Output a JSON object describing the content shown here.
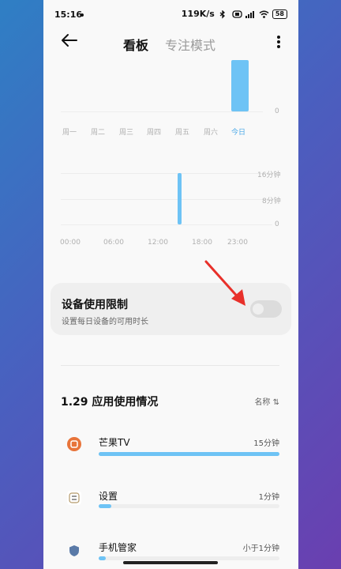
{
  "status_bar": {
    "time": "15:16",
    "network_speed": "119K/s",
    "battery": "58"
  },
  "header": {
    "tab_active": "看板",
    "tab_inactive": "专注模式"
  },
  "week_chart": {
    "y_tick": "0",
    "days": [
      "周一",
      "周二",
      "周三",
      "周四",
      "周五",
      "周六",
      "今日"
    ],
    "today_color": "#4aa8e8"
  },
  "day_chart": {
    "y_ticks": [
      "16分钟",
      "8分钟",
      "0"
    ],
    "x_ticks": [
      "00:00",
      "06:00",
      "12:00",
      "18:00",
      "23:00"
    ]
  },
  "chart_data": [
    {
      "type": "bar",
      "categories": [
        "周一",
        "周二",
        "周三",
        "周四",
        "周五",
        "周六",
        "今日"
      ],
      "values": [
        0,
        0,
        0,
        0,
        0,
        0,
        1
      ]
    },
    {
      "type": "bar",
      "x_ticks": [
        "00:00",
        "06:00",
        "12:00",
        "18:00",
        "23:00"
      ],
      "y_ticks": [
        "16分钟",
        "8分钟",
        "0"
      ],
      "series": [
        {
          "x": "15:00",
          "value_minutes": 16
        }
      ]
    }
  ],
  "device_limit": {
    "title": "设备使用限制",
    "subtitle": "设置每日设备的可用时长",
    "enabled": false
  },
  "usage": {
    "title": "1.29 应用使用情况",
    "sort_label": "名称 ⇅",
    "apps": [
      {
        "name": "芒果TV",
        "time": "15分钟",
        "progress": 1.0,
        "icon": "mango-tv-icon",
        "color": "#e8743a"
      },
      {
        "name": "设置",
        "time": "1分钟",
        "progress": 0.07,
        "icon": "settings-icon",
        "color": "#888888"
      },
      {
        "name": "手机管家",
        "time": "小于1分钟",
        "progress": 0.04,
        "icon": "phone-manager-icon",
        "color": "#5a7aa8"
      }
    ]
  },
  "colors": {
    "bar": "#6ec3f5",
    "arrow": "#e8302a"
  }
}
